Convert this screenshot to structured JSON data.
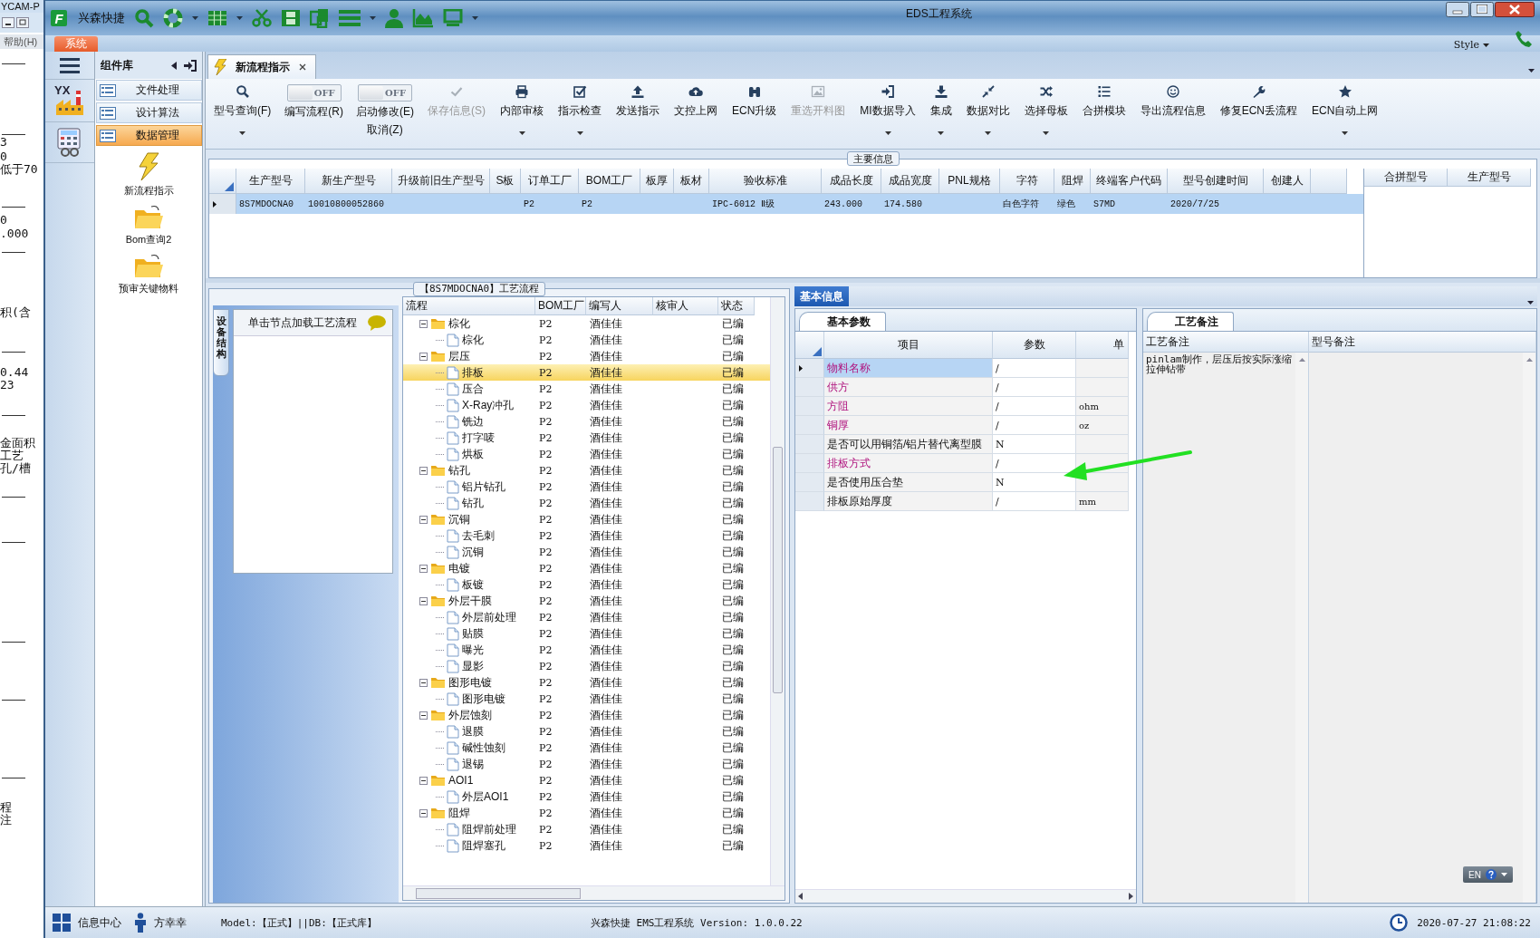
{
  "background_window": {
    "title": "YCAM-P",
    "menu_item": "帮助(H)",
    "fragments": [
      "3",
      "0",
      "低于70",
      "0",
      ".000",
      "积(含",
      "0.44",
      "23",
      "金面积",
      "工艺",
      "孔/槽",
      "程",
      "注"
    ]
  },
  "window": {
    "logo_text": "F",
    "app_name": "兴森快捷",
    "title": "EDS工程系统",
    "menu_tab": "系统",
    "style_menu": "Style"
  },
  "nav": {
    "logo_text": "YX"
  },
  "sidebar": {
    "title": "组件库",
    "categories": [
      {
        "label": "文件处理",
        "selected": false
      },
      {
        "label": "设计算法",
        "selected": false
      },
      {
        "label": "数据管理",
        "selected": true
      }
    ],
    "items": [
      {
        "label": "新流程指示"
      },
      {
        "label": "Bom查询2"
      },
      {
        "label": "预审关键物料"
      }
    ]
  },
  "tabs": [
    {
      "label": "新流程指示",
      "selected": true
    }
  ],
  "toolbar": [
    {
      "kind": "button",
      "label": "型号查询(F)",
      "dropdown": true,
      "disabled": false
    },
    {
      "kind": "toggle",
      "state_text": "OFF",
      "on": false,
      "label": "编写流程(R)"
    },
    {
      "kind": "toggle",
      "state_text": "OFF",
      "on": false,
      "label": "启动修改(E)",
      "sublabel": "取消(Z)"
    },
    {
      "kind": "button",
      "label": "保存信息(S)",
      "dropdown": false,
      "disabled": true
    },
    {
      "kind": "button",
      "label": "内部审核",
      "dropdown": true,
      "disabled": false
    },
    {
      "kind": "button",
      "label": "指示检查",
      "dropdown": true,
      "disabled": false
    },
    {
      "kind": "button",
      "label": "发送指示",
      "dropdown": false,
      "disabled": false
    },
    {
      "kind": "button",
      "label": "文控上网",
      "dropdown": false,
      "disabled": false
    },
    {
      "kind": "button",
      "label": "ECN升级",
      "dropdown": false,
      "disabled": false
    },
    {
      "kind": "button",
      "label": "重选开料图",
      "dropdown": false,
      "disabled": true
    },
    {
      "kind": "button",
      "label": "MI数据导入",
      "dropdown": true,
      "disabled": false
    },
    {
      "kind": "button",
      "label": "集成",
      "dropdown": true,
      "disabled": false
    },
    {
      "kind": "button",
      "label": "数据对比",
      "dropdown": true,
      "disabled": false
    },
    {
      "kind": "button",
      "label": "选择母板",
      "dropdown": true,
      "disabled": false
    },
    {
      "kind": "button",
      "label": "合拼模块",
      "dropdown": false,
      "disabled": false
    },
    {
      "kind": "button",
      "label": "导出流程信息",
      "dropdown": false,
      "disabled": false
    },
    {
      "kind": "button",
      "label": "修复ECN丢流程",
      "dropdown": false,
      "disabled": false
    },
    {
      "kind": "button",
      "label": "ECN自动上网",
      "dropdown": true,
      "disabled": false
    }
  ],
  "main_info": {
    "title": "主要信息",
    "columns": [
      "生产型号",
      "新生产型号",
      "升级前旧生产型号",
      "S板",
      "订单工厂",
      "BOM工厂",
      "板厚",
      "板材",
      "验收标准",
      "成品长度",
      "成品宽度",
      "PNL规格",
      "字符",
      "阻焊",
      "终端客户代码",
      "型号创建时间",
      "创建人"
    ],
    "rows": [
      {
        "selected": true,
        "cells": [
          "8S7MDOCNA0",
          "10010800052860",
          null,
          null,
          "P2",
          "P2",
          null,
          null,
          "IPC-6012 Ⅱ级",
          "243.000",
          "174.580",
          null,
          "白色字符",
          "绿色",
          "S7MD",
          "2020/7/25",
          null
        ]
      }
    ],
    "side_columns": [
      "合拼型号",
      "生产型号"
    ]
  },
  "process": {
    "title": "【8S7MDOCNA0】工艺流程",
    "side_tab": "设备结构",
    "hint": "单击节点加载工艺流程",
    "columns": [
      "流程",
      "BOM工厂",
      "编写人",
      "核审人",
      "状态"
    ],
    "tree": [
      {
        "name": "棕化",
        "bom": "P2",
        "writer": "酒佳佳",
        "status": "已编",
        "expanded": true,
        "selected": false,
        "children": [
          {
            "name": "棕化",
            "bom": "P2",
            "writer": "酒佳佳",
            "status": "已编",
            "selected": false
          }
        ]
      },
      {
        "name": "层压",
        "bom": "P2",
        "writer": "酒佳佳",
        "status": "已编",
        "expanded": true,
        "selected": false,
        "children": [
          {
            "name": "排板",
            "bom": "P2",
            "writer": "酒佳佳",
            "status": "已编",
            "selected": true
          },
          {
            "name": "压合",
            "bom": "P2",
            "writer": "酒佳佳",
            "status": "已编",
            "selected": false
          },
          {
            "name": "X-Ray冲孔",
            "bom": "P2",
            "writer": "酒佳佳",
            "status": "已编",
            "selected": false
          },
          {
            "name": "铣边",
            "bom": "P2",
            "writer": "酒佳佳",
            "status": "已编",
            "selected": false
          },
          {
            "name": "打字唛",
            "bom": "P2",
            "writer": "酒佳佳",
            "status": "已编",
            "selected": false
          },
          {
            "name": "烘板",
            "bom": "P2",
            "writer": "酒佳佳",
            "status": "已编",
            "selected": false
          }
        ]
      },
      {
        "name": "钻孔",
        "bom": "P2",
        "writer": "酒佳佳",
        "status": "已编",
        "expanded": true,
        "selected": false,
        "children": [
          {
            "name": "铝片钻孔",
            "bom": "P2",
            "writer": "酒佳佳",
            "status": "已编",
            "selected": false
          },
          {
            "name": "钻孔",
            "bom": "P2",
            "writer": "酒佳佳",
            "status": "已编",
            "selected": false
          }
        ]
      },
      {
        "name": "沉铜",
        "bom": "P2",
        "writer": "酒佳佳",
        "status": "已编",
        "expanded": true,
        "selected": false,
        "children": [
          {
            "name": "去毛刺",
            "bom": "P2",
            "writer": "酒佳佳",
            "status": "已编",
            "selected": false
          },
          {
            "name": "沉铜",
            "bom": "P2",
            "writer": "酒佳佳",
            "status": "已编",
            "selected": false
          }
        ]
      },
      {
        "name": "电镀",
        "bom": "P2",
        "writer": "酒佳佳",
        "status": "已编",
        "expanded": true,
        "selected": false,
        "children": [
          {
            "name": "板镀",
            "bom": "P2",
            "writer": "酒佳佳",
            "status": "已编",
            "selected": false
          }
        ]
      },
      {
        "name": "外层干膜",
        "bom": "P2",
        "writer": "酒佳佳",
        "status": "已编",
        "expanded": true,
        "selected": false,
        "children": [
          {
            "name": "外层前处理",
            "bom": "P2",
            "writer": "酒佳佳",
            "status": "已编",
            "selected": false
          },
          {
            "name": "贴膜",
            "bom": "P2",
            "writer": "酒佳佳",
            "status": "已编",
            "selected": false
          },
          {
            "name": "曝光",
            "bom": "P2",
            "writer": "酒佳佳",
            "status": "已编",
            "selected": false
          },
          {
            "name": "显影",
            "bom": "P2",
            "writer": "酒佳佳",
            "status": "已编",
            "selected": false
          }
        ]
      },
      {
        "name": "图形电镀",
        "bom": "P2",
        "writer": "酒佳佳",
        "status": "已编",
        "expanded": true,
        "selected": false,
        "children": [
          {
            "name": "图形电镀",
            "bom": "P2",
            "writer": "酒佳佳",
            "status": "已编",
            "selected": false
          }
        ]
      },
      {
        "name": "外层蚀刻",
        "bom": "P2",
        "writer": "酒佳佳",
        "status": "已编",
        "expanded": true,
        "selected": false,
        "children": [
          {
            "name": "退膜",
            "bom": "P2",
            "writer": "酒佳佳",
            "status": "已编",
            "selected": false
          },
          {
            "name": "碱性蚀刻",
            "bom": "P2",
            "writer": "酒佳佳",
            "status": "已编",
            "selected": false
          },
          {
            "name": "退锡",
            "bom": "P2",
            "writer": "酒佳佳",
            "status": "已编",
            "selected": false
          }
        ]
      },
      {
        "name": "AOI1",
        "bom": "P2",
        "writer": "酒佳佳",
        "status": "已编",
        "expanded": true,
        "selected": false,
        "children": [
          {
            "name": "外层AOI1",
            "bom": "P2",
            "writer": "酒佳佳",
            "status": "已编",
            "selected": false
          }
        ]
      },
      {
        "name": "阻焊",
        "bom": "P2",
        "writer": "酒佳佳",
        "status": "已编",
        "expanded": true,
        "selected": false,
        "children": [
          {
            "name": "阻焊前处理",
            "bom": "P2",
            "writer": "酒佳佳",
            "status": "已编",
            "selected": false
          },
          {
            "name": "阻焊塞孔",
            "bom": "P2",
            "writer": "酒佳佳",
            "status": "已编",
            "selected": false
          }
        ]
      }
    ]
  },
  "basic_info": {
    "tab": "基本信息",
    "params": {
      "tab": "基本参数",
      "columns": [
        "项目",
        "参数",
        "单"
      ],
      "rows": [
        {
          "item": "物料名称",
          "value": "/",
          "required": true,
          "selected": true
        },
        {
          "item": "供方",
          "value": "/",
          "required": true,
          "selected": false
        },
        {
          "item": "方阻",
          "value": "/",
          "unit": "ohm",
          "required": true,
          "selected": false
        },
        {
          "item": "铜厚",
          "value": "/",
          "unit": "oz",
          "required": true,
          "selected": false
        },
        {
          "item": "是否可以用铜箔/铝片替代离型膜",
          "value": "N",
          "required": false,
          "selected": false
        },
        {
          "item": "排板方式",
          "value": "/",
          "required": true,
          "selected": false
        },
        {
          "item": "是否使用压合垫",
          "value": "N",
          "required": false,
          "selected": false
        },
        {
          "item": "排板原始厚度",
          "value": "/",
          "unit": "mm",
          "required": false,
          "selected": false
        }
      ]
    },
    "remarks": {
      "tab": "工艺备注",
      "columns": [
        "工艺备注",
        "型号备注"
      ],
      "process_note": "pinlam制作，层压后按实际涨缩拉伸钻带"
    }
  },
  "language": {
    "label": "EN"
  },
  "status_bar": {
    "info_center": "信息中心",
    "user": "方幸幸",
    "model": "Model:【正式】||DB:【正式库】",
    "version": "兴森快捷 EMS工程系统 Version: 1.0.0.22",
    "time": "2020-07-27 21:08:22"
  }
}
